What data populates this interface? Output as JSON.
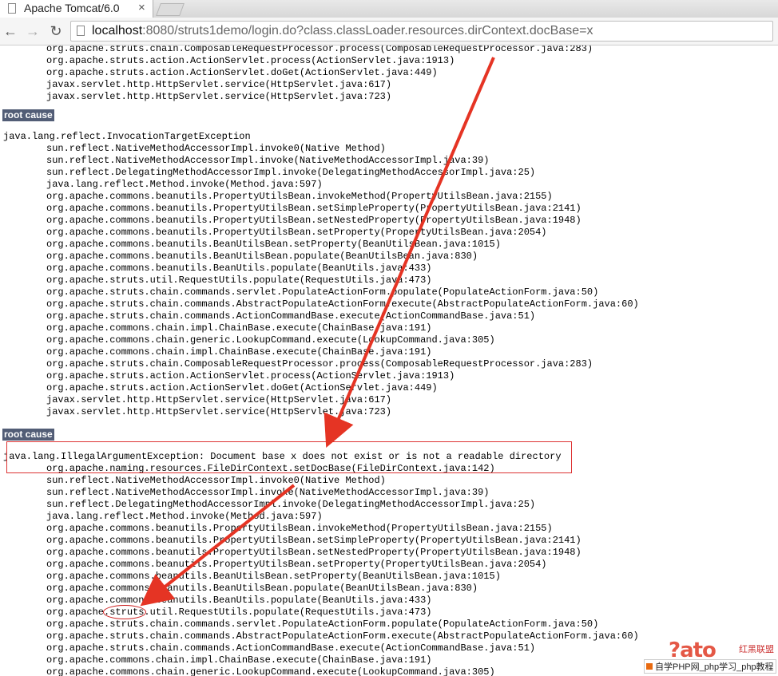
{
  "tab": {
    "title": "Apache Tomcat/6.0",
    "close": "×"
  },
  "toolbar": {
    "back": "←",
    "forward": "→",
    "reload": "↻",
    "url_host": "localhost",
    "url_rest": ":8080/struts1demo/login.do?class.classLoader.resources.dirContext.docBase=x"
  },
  "trace_top": [
    "org.apache.struts.chain.ComposableRequestProcessor.process(ComposableRequestProcessor.java:283)",
    "org.apache.struts.action.ActionServlet.process(ActionServlet.java:1913)",
    "org.apache.struts.action.ActionServlet.doGet(ActionServlet.java:449)",
    "javax.servlet.http.HttpServlet.service(HttpServlet.java:617)",
    "javax.servlet.http.HttpServlet.service(HttpServlet.java:723)"
  ],
  "root_cause_label": "root cause",
  "cause1": {
    "exception": "java.lang.reflect.InvocationTargetException",
    "frames": [
      "sun.reflect.NativeMethodAccessorImpl.invoke0(Native Method)",
      "sun.reflect.NativeMethodAccessorImpl.invoke(NativeMethodAccessorImpl.java:39)",
      "sun.reflect.DelegatingMethodAccessorImpl.invoke(DelegatingMethodAccessorImpl.java:25)",
      "java.lang.reflect.Method.invoke(Method.java:597)",
      "org.apache.commons.beanutils.PropertyUtilsBean.invokeMethod(PropertyUtilsBean.java:2155)",
      "org.apache.commons.beanutils.PropertyUtilsBean.setSimpleProperty(PropertyUtilsBean.java:2141)",
      "org.apache.commons.beanutils.PropertyUtilsBean.setNestedProperty(PropertyUtilsBean.java:1948)",
      "org.apache.commons.beanutils.PropertyUtilsBean.setProperty(PropertyUtilsBean.java:2054)",
      "org.apache.commons.beanutils.BeanUtilsBean.setProperty(BeanUtilsBean.java:1015)",
      "org.apache.commons.beanutils.BeanUtilsBean.populate(BeanUtilsBean.java:830)",
      "org.apache.commons.beanutils.BeanUtils.populate(BeanUtils.java:433)",
      "org.apache.struts.util.RequestUtils.populate(RequestUtils.java:473)",
      "org.apache.struts.chain.commands.servlet.PopulateActionForm.populate(PopulateActionForm.java:50)",
      "org.apache.struts.chain.commands.AbstractPopulateActionForm.execute(AbstractPopulateActionForm.java:60)",
      "org.apache.struts.chain.commands.ActionCommandBase.execute(ActionCommandBase.java:51)",
      "org.apache.commons.chain.impl.ChainBase.execute(ChainBase.java:191)",
      "org.apache.commons.chain.generic.LookupCommand.execute(LookupCommand.java:305)",
      "org.apache.commons.chain.impl.ChainBase.execute(ChainBase.java:191)",
      "org.apache.struts.chain.ComposableRequestProcessor.process(ComposableRequestProcessor.java:283)",
      "org.apache.struts.action.ActionServlet.process(ActionServlet.java:1913)",
      "org.apache.struts.action.ActionServlet.doGet(ActionServlet.java:449)",
      "javax.servlet.http.HttpServlet.service(HttpServlet.java:617)",
      "javax.servlet.http.HttpServlet.service(HttpServlet.java:723)"
    ]
  },
  "cause2": {
    "exception": "java.lang.IllegalArgumentException: Document base x does not exist or is not a readable directory",
    "frames": [
      "org.apache.naming.resources.FileDirContext.setDocBase(FileDirContext.java:142)",
      "sun.reflect.NativeMethodAccessorImpl.invoke0(Native Method)",
      "sun.reflect.NativeMethodAccessorImpl.invoke(NativeMethodAccessorImpl.java:39)",
      "sun.reflect.DelegatingMethodAccessorImpl.invoke(DelegatingMethodAccessorImpl.java:25)",
      "java.lang.reflect.Method.invoke(Method.java:597)",
      "org.apache.commons.beanutils.PropertyUtilsBean.invokeMethod(PropertyUtilsBean.java:2155)",
      "org.apache.commons.beanutils.PropertyUtilsBean.setSimpleProperty(PropertyUtilsBean.java:2141)",
      "org.apache.commons.beanutils.PropertyUtilsBean.setNestedProperty(PropertyUtilsBean.java:1948)",
      "org.apache.commons.beanutils.PropertyUtilsBean.setProperty(PropertyUtilsBean.java:2054)",
      "org.apache.commons.beanutils.BeanUtilsBean.setProperty(BeanUtilsBean.java:1015)",
      "org.apache.commons.beanutils.BeanUtilsBean.populate(BeanUtilsBean.java:830)",
      "org.apache.commons.beanutils.BeanUtils.populate(BeanUtils.java:433)",
      "org.apache.struts.util.RequestUtils.populate(RequestUtils.java:473)",
      "org.apache.struts.chain.commands.servlet.PopulateActionForm.populate(PopulateActionForm.java:50)",
      "org.apache.struts.chain.commands.AbstractPopulateActionForm.execute(AbstractPopulateActionForm.java:60)",
      "org.apache.struts.chain.commands.ActionCommandBase.execute(ActionCommandBase.java:51)",
      "org.apache.commons.chain.impl.ChainBase.execute(ChainBase.java:191)",
      "org.apache.commons.chain.generic.LookupCommand.execute(LookupCommand.java:305)"
    ]
  },
  "watermark": {
    "logo": "?ato",
    "brand": "红黑联盟",
    "badge": "自学PHP网_php学习_php教程"
  },
  "colors": {
    "annotation": "#e53424",
    "cause_bg": "#525d76"
  }
}
